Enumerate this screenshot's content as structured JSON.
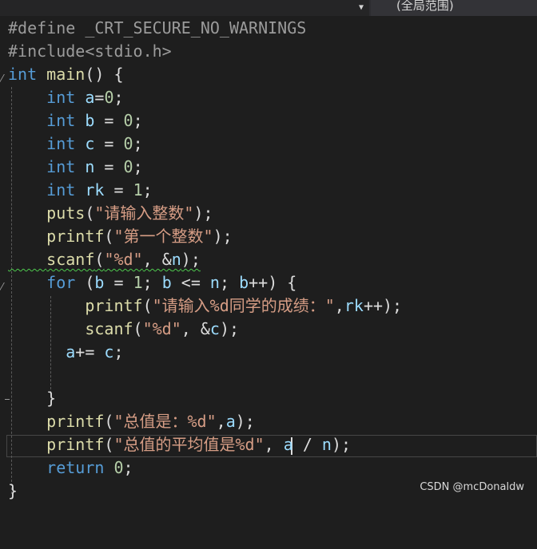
{
  "toolbar": {
    "scope_label": "(全局范围)",
    "dropdown_chevron": "▼"
  },
  "code_lines": [
    "#define _CRT_SECURE_NO_WARNINGS",
    "#include<stdio.h>",
    "int main() {",
    "    int a=0;",
    "    int b = 0;",
    "    int c = 0;",
    "    int n = 0;",
    "    int rk = 1;",
    "    puts(\"请输入整数\");",
    "    printf(\"第一个整数\");",
    "    scanf(\"%d\", &n);",
    "    for (b = 1; b <= n; b++) {",
    "        printf(\"请输入%d同学的成绩：\",rk++);",
    "        scanf(\"%d\", &c);",
    "      a+= c;",
    "",
    "    }",
    "    printf(\"总值是：%d\",a);",
    "    printf(\"总值的平均值是%d\", a / n);",
    "    return 0;",
    "}"
  ],
  "colors": {
    "background": "#1e1e1e",
    "keyword": "#569cd6",
    "string": "#d69d85",
    "function": "#dcdcaa",
    "variable": "#9cdcfe",
    "number": "#b5cea8",
    "preprocessor": "#9b9b9b"
  },
  "watermark": "CSDN @mcDonaldw"
}
